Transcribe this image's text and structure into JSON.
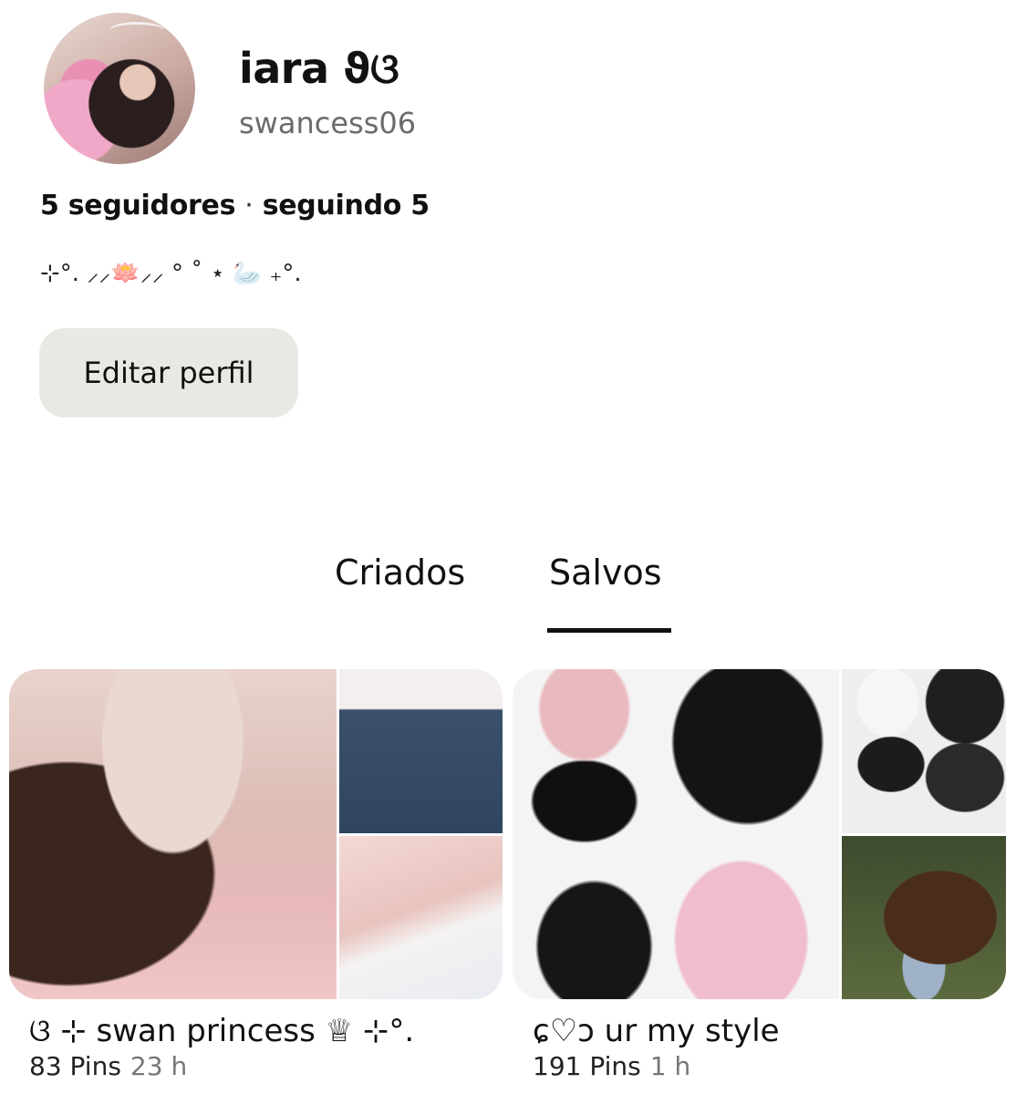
{
  "profile": {
    "display_name": "iara ϑଓ",
    "username": "swancess06",
    "followers": "5 seguidores",
    "separator": "·",
    "following": "seguindo 5",
    "bio": "⊹°. ⸝⸝🪷⸝⸝ ° ˚ ⋆ 🦢 ₊°.",
    "edit_button": "Editar perfil"
  },
  "tabs": [
    {
      "label": "Criados",
      "active": false
    },
    {
      "label": "Salvos",
      "active": true
    }
  ],
  "boards": [
    {
      "title": "ଓ ⊹ swan princess ♕ ⊹°.",
      "pins": "83 Pins",
      "time": "23 h"
    },
    {
      "title": "ɕ♡ɔ ur my style",
      "pins": "191 Pins",
      "time": "1 h"
    }
  ]
}
